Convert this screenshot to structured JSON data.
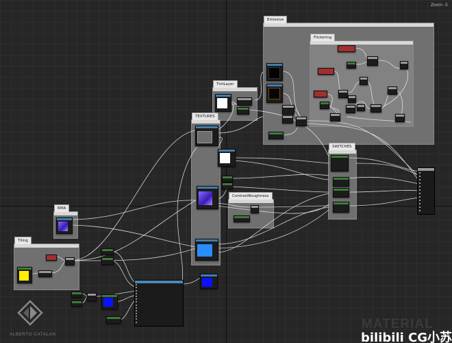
{
  "viewport": {
    "zoom_label": "Zoom -5"
  },
  "comments": {
    "emissive": "Emissive",
    "flickering": "Flickering",
    "tint_layer": "TintLayer",
    "textures": "TEXTURES",
    "contrast_roughness": "ContrastRoughness",
    "switches": "SWITCHES",
    "rma": "RMA",
    "tiling": "Tiling"
  },
  "branding": {
    "author": "ALBERTO CATALAN",
    "watermark": "MATERIAL",
    "channel": "bilibili CG小苏"
  },
  "colors": {
    "background": "#262626",
    "comment_box": "#707070",
    "wire": "#e8e8e8",
    "texture_node_header": "#3e7fb0",
    "param_node_header": "#3f7a3a",
    "vector_param_header": "#8a2a2a",
    "white_swatch": "#ffffff",
    "yellow_swatch": "#ffee00",
    "blue_swatch": "#0a12ff",
    "purple_swatch": "#7a3cff",
    "dark_swatch": "#050505"
  }
}
